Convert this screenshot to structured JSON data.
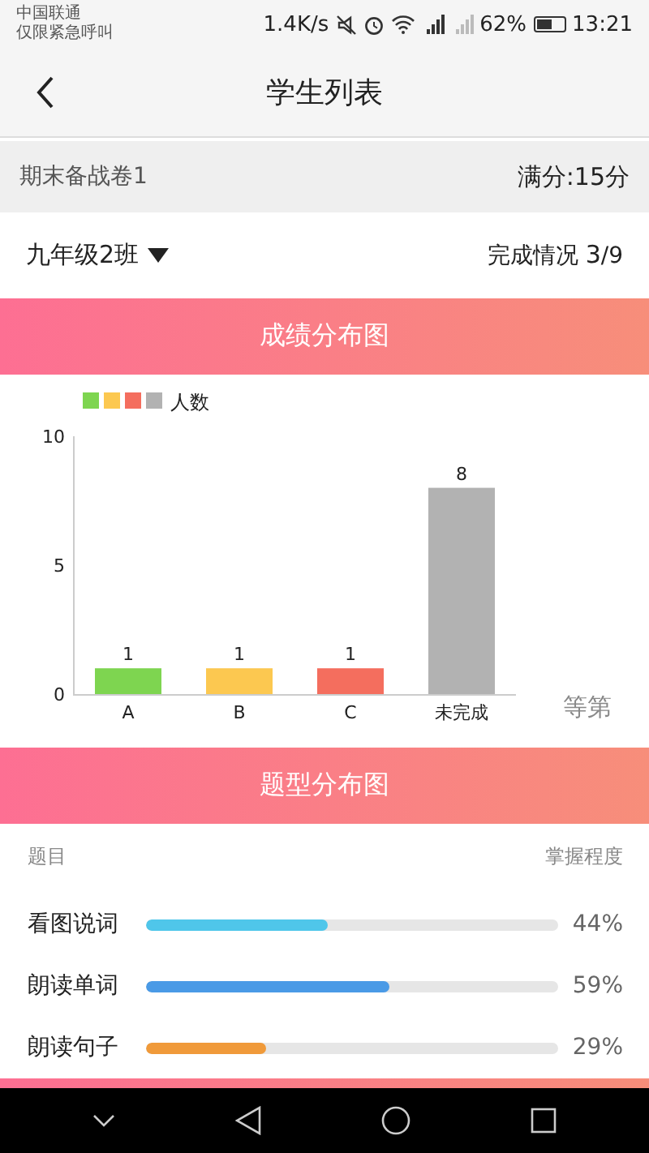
{
  "status_bar": {
    "carrier": "中国联通",
    "carrier_note": "仅限紧急呼叫",
    "speed": "1.4K/s",
    "battery": "62%",
    "time": "13:21"
  },
  "header": {
    "title": "学生列表"
  },
  "exam": {
    "name": "期末备战卷1",
    "full_score": "满分:15分"
  },
  "class_row": {
    "class_name": "九年级2班",
    "progress_label": "完成情况",
    "done": "3",
    "total": "/9"
  },
  "grade_section": {
    "title": "成绩分布图",
    "chart_data": {
      "type": "bar",
      "xlabel": "等第",
      "categories": [
        "A",
        "B",
        "C",
        "未完成"
      ],
      "colors": [
        "#7ed550",
        "#fcc850",
        "#f46e5e",
        "#b2b2b2"
      ],
      "series": [
        {
          "name": "人数",
          "values": [
            1,
            1,
            1,
            8
          ]
        }
      ],
      "ylim": [
        0,
        10
      ],
      "yticks": [
        0,
        5,
        10
      ],
      "data_labels": true
    }
  },
  "type_section": {
    "title": "题型分布图",
    "col_left": "题目",
    "col_right": "掌握程度",
    "rows": [
      {
        "name": "看图说词",
        "level": 0.44,
        "reading": "44%",
        "color": "#4fc6ea"
      },
      {
        "name": "朗读单词",
        "level": 0.59,
        "reading": "59%",
        "color": "#4a9ae6"
      },
      {
        "name": "朗读句子",
        "level": 0.29,
        "reading": "29%",
        "color": "#f09a3a"
      }
    ]
  }
}
